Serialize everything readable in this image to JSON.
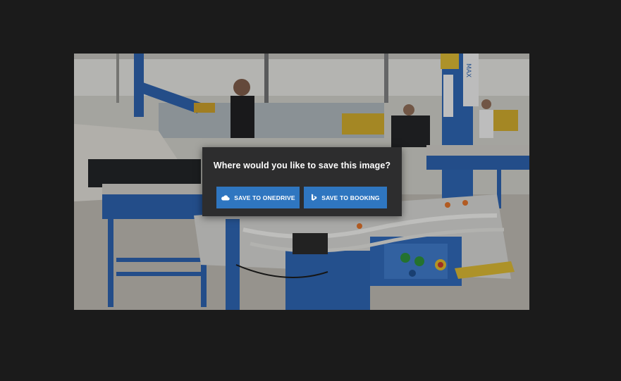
{
  "dialog": {
    "title": "Where would you like to save this image?",
    "buttons": [
      {
        "label": "SAVE TO ONEDRIVE",
        "icon": "cloud-icon"
      },
      {
        "label": "SAVE TO BOOKING",
        "icon": "bing-icon"
      }
    ]
  },
  "colors": {
    "backdrop": "#1b1b1b",
    "dialog_bg": "#2d2d2e",
    "button_bg": "#2f76c0",
    "text": "#ffffff"
  },
  "photo": {
    "sign_text": "MAX"
  }
}
